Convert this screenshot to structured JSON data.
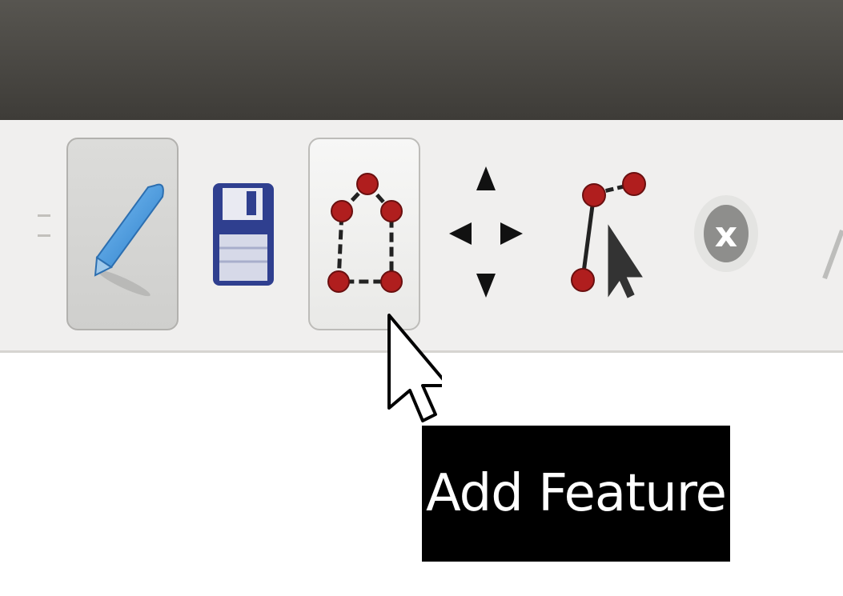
{
  "window": {
    "titlebar_color": "#4a4844",
    "toolbar_color": "#f0efee"
  },
  "toolbar": {
    "tools": [
      {
        "icon": "pencil-icon",
        "name": "toggle-editing",
        "state": "pressed"
      },
      {
        "icon": "floppy-disk-icon",
        "name": "save-edits",
        "state": "normal"
      },
      {
        "icon": "polygon-nodes-icon",
        "name": "add-feature",
        "state": "hover"
      },
      {
        "icon": "move-arrows-icon",
        "name": "move-feature",
        "state": "normal"
      },
      {
        "icon": "vertex-tool-icon",
        "name": "vertex-tool",
        "state": "normal"
      },
      {
        "icon": "delete-x-icon",
        "name": "delete-selected",
        "state": "normal"
      }
    ],
    "accent_node_color": "#b01e1e",
    "pencil_color": "#3a8fd8"
  },
  "tooltip": {
    "text": "Add Feature"
  }
}
